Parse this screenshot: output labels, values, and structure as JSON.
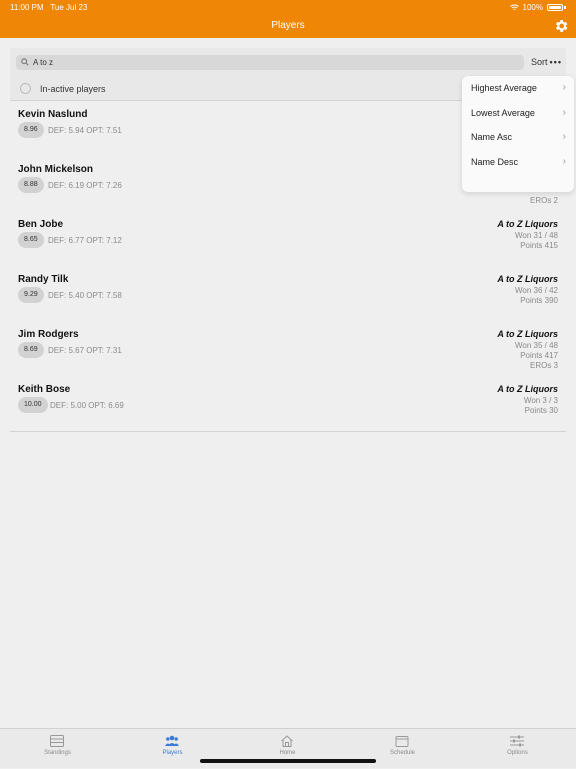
{
  "status_bar": {
    "time": "11:00 PM",
    "date": "Tue Jul 23",
    "battery": "100%"
  },
  "nav": {
    "title": "Players"
  },
  "search": {
    "value": "A to z",
    "placeholder": ""
  },
  "sort": {
    "label": "Sort"
  },
  "filter": {
    "inactive_label": "In-active players"
  },
  "sort_menu": {
    "items": [
      {
        "label": "Highest Average"
      },
      {
        "label": "Lowest Average"
      },
      {
        "label": "Name Asc"
      },
      {
        "label": "Name Desc"
      }
    ]
  },
  "players": [
    {
      "name": "Kevin Naslund",
      "avg": "8.96",
      "stats": "DEF: 5.94 OPT: 7.51",
      "team": "",
      "won": "",
      "points": "",
      "eros": ""
    },
    {
      "name": "John Mickelson",
      "avg": "8.88",
      "stats": "DEF: 6.19 OPT: 7.26",
      "team": "",
      "won": "",
      "points": "",
      "eros": "EROs 2"
    },
    {
      "name": "Ben Jobe",
      "avg": "8.65",
      "stats": "DEF: 6.77 OPT: 7.12",
      "team": "A to Z Liquors",
      "won": "Won 31 / 48",
      "points": "Points 415",
      "eros": ""
    },
    {
      "name": "Randy Tilk",
      "avg": "9.29",
      "stats": "DEF: 5.40 OPT: 7.58",
      "team": "A to Z Liquors",
      "won": "Won 36 / 42",
      "points": "Points 390",
      "eros": ""
    },
    {
      "name": "Jim Rodgers",
      "avg": "8.69",
      "stats": "DEF: 5.67 OPT: 7.31",
      "team": "A to Z Liquors",
      "won": "Won 35 / 48",
      "points": "Points 417",
      "eros": "EROs 3"
    },
    {
      "name": "Keith Bose",
      "avg": "10.00",
      "stats": "DEF: 5.00 OPT: 6.69",
      "team": "A to Z Liquors",
      "won": "Won 3 / 3",
      "points": "Points 30",
      "eros": ""
    }
  ],
  "tabs": [
    {
      "label": "Standings",
      "icon": "standings-icon",
      "active": false
    },
    {
      "label": "Players",
      "icon": "players-icon",
      "active": true
    },
    {
      "label": "Home",
      "icon": "home-icon",
      "active": false
    },
    {
      "label": "Schedule",
      "icon": "calendar-icon",
      "active": false
    },
    {
      "label": "Options",
      "icon": "sliders-icon",
      "active": false
    }
  ],
  "colors": {
    "header": "#ef8606",
    "active_tab": "#3a7bd5",
    "background": "#efefef"
  }
}
